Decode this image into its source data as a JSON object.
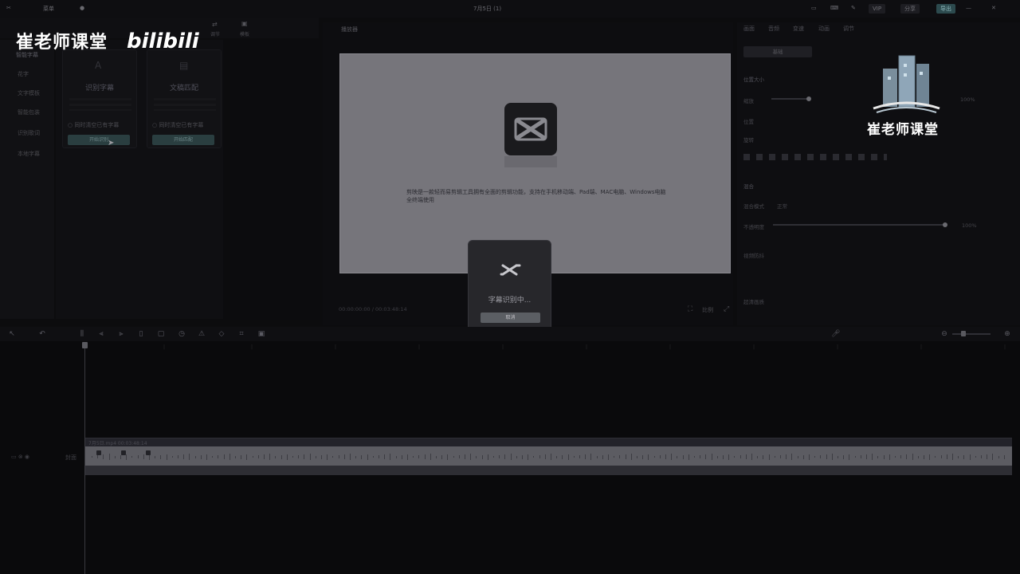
{
  "topbar": {
    "menu": "菜单",
    "title": "7月5日 (1)",
    "vip": "VIP",
    "share": "分享",
    "export": "导出"
  },
  "left_nav": {
    "items": [
      "智能字幕",
      "花字",
      "文字模板",
      "智能包装",
      "识别歌词",
      "本地字幕"
    ]
  },
  "left_tools": {
    "tab_adjust": "调节",
    "tab_template": "模板"
  },
  "cards": [
    {
      "title": "识别字幕",
      "checkbox": "同时清空已有字幕",
      "button": "开始识别"
    },
    {
      "title": "文稿匹配",
      "checkbox": "同时清空已有字幕",
      "button": "开始匹配"
    }
  ],
  "player": {
    "label": "播放器",
    "time": "00:00:00:00 / 00:03:48:14",
    "preview_text": "剪映是一款轻而易剪辑工具拥有全面的剪辑功能，支持在手机移动端、Pad端、MAC电脑、Windows电脑全终端使用"
  },
  "dialog": {
    "message": "字幕识别中...",
    "cancel": "取消"
  },
  "right_panel": {
    "tabs": [
      "画面",
      "音频",
      "变速",
      "动画",
      "调节"
    ],
    "sub_tab": "基础",
    "section_position": "位置大小",
    "scale_label": "缩放",
    "scale_value": "100%",
    "pos_label": "位置",
    "rotate_label": "旋转",
    "blend_label": "混合",
    "blend_mode_label": "混合模式",
    "blend_mode_value": "正常",
    "opacity_label": "不透明度",
    "opacity_value": "100%",
    "stabilize_label": "视频防抖",
    "hd_label": "超清画质"
  },
  "timeline": {
    "clip_name": "7月5日.mp4  00:03:48:14",
    "cover_label": "封面"
  },
  "watermark": {
    "text": "崔老师课堂",
    "bili": "bilibili",
    "text2": "崔老师课堂"
  }
}
